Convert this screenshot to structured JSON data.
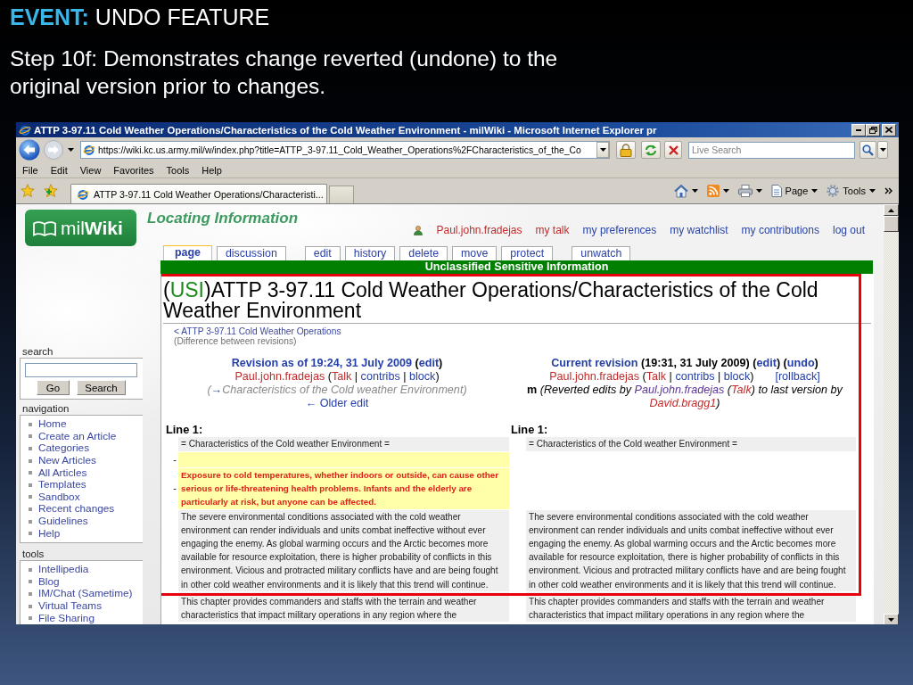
{
  "slide": {
    "heading": "**EVENT:** UNDO FEATURE",
    "step": "Step 10f: Demonstrates change reverted (undone) to the original version prior to changes."
  },
  "window": {
    "title": "ATTP 3-97.11 Cold Weather Operations/Characteristics of the Cold Weather Environment - milWiki - Microsoft Internet Explorer pr"
  },
  "address_bar": {
    "url": "https://wiki.kc.us.army.mil/w/index.php?title=ATTP_3-97.11_Cold_Weather_Operations%2FCharacteristics_of_the_Co"
  },
  "search": {
    "placeholder": "Live Search"
  },
  "menu_bar": [
    "File",
    "Edit",
    "View",
    "Favorites",
    "Tools",
    "Help"
  ],
  "browser_tabs": [
    {
      "label": "ATTP 3-97.11 Cold Weather Operations/Characteristi...",
      "selected": true
    }
  ],
  "command_bar": [
    {
      "kind": "page",
      "label": "Page"
    },
    {
      "kind": "tools",
      "label": "Tools"
    }
  ],
  "wiki": {
    "logo": "mil**Wiki**",
    "site_notice": "Locating Information",
    "user_links": [
      {
        "label": "Paul.john.fradejas",
        "kind": "user"
      },
      {
        "label": "my talk",
        "kind": "new"
      },
      {
        "label": "my preferences",
        "kind": "link"
      },
      {
        "label": "my watchlist",
        "kind": "link"
      },
      {
        "label": "my contributions",
        "kind": "link"
      },
      {
        "label": "log out",
        "kind": "link"
      }
    ],
    "tab_groups": [
      [
        {
          "label": "page",
          "selected": true
        },
        {
          "label": "discussion",
          "selected": false
        }
      ],
      [
        {
          "label": "edit",
          "selected": false
        },
        {
          "label": "history",
          "selected": false
        },
        {
          "label": "delete",
          "selected": false
        },
        {
          "label": "move",
          "selected": false
        },
        {
          "label": "protect",
          "selected": false
        }
      ],
      [
        {
          "label": "unwatch",
          "selected": false
        }
      ]
    ],
    "banner": "Unclassified Sensitive Information",
    "sidebar": {
      "search": {
        "heading": "search",
        "buttons": [
          "Go",
          "Search"
        ]
      },
      "portlets": [
        {
          "heading": "navigation",
          "items": [
            "Home",
            "Create an Article",
            "Categories",
            "New Articles",
            "All Articles",
            "Templates",
            "Sandbox",
            "Recent changes",
            "Guidelines",
            "Help"
          ]
        },
        {
          "heading": "tools",
          "items": [
            "Intellipedia",
            "Blog",
            "IM/Chat (Sametime)",
            "Virtual Teams",
            "File Sharing"
          ]
        }
      ]
    },
    "article": {
      "title": [
        {
          "text": "(",
          "kind": "plain"
        },
        {
          "text": "USI",
          "kind": "marking"
        },
        {
          "text": ")ATTP 3-97.11 Cold Weather Operations/Characteristics of the Cold Weather Environment",
          "kind": "plain"
        }
      ],
      "back_link": "< ATTP 3-97.11 Cold Weather Operations",
      "subtitle": "(Difference between revisions)",
      "revisions": [
        {
          "lines": [
            {
              "segments": [
                {
                  "text": "Revision as of 19:24, 31 July 2009",
                  "kind": "link"
                },
                {
                  "text": " (",
                  "kind": "plain"
                },
                {
                  "text": "edit",
                  "kind": "link"
                },
                {
                  "text": ")",
                  "kind": "plain"
                }
              ]
            },
            {
              "segments": [
                {
                  "text": "Paul.john.fradejas",
                  "kind": "new"
                },
                {
                  "text": " (",
                  "kind": "plain"
                },
                {
                  "text": "Talk",
                  "kind": "new"
                },
                {
                  "text": " | ",
                  "kind": "plain"
                },
                {
                  "text": "contribs",
                  "kind": "link"
                },
                {
                  "text": " | ",
                  "kind": "plain"
                },
                {
                  "text": "block",
                  "kind": "link"
                },
                {
                  "text": ")",
                  "kind": "plain"
                }
              ]
            },
            {
              "segments": [
                {
                  "text": "(",
                  "kind": "muted"
                },
                {
                  "text": "→",
                  "kind": "link"
                },
                {
                  "text": "Characteristics of the Cold weather Environment",
                  "kind": "muted"
                },
                {
                  "text": ")",
                  "kind": "muted"
                }
              ]
            },
            {
              "segments": [
                {
                  "text": "← Older edit",
                  "kind": "link"
                }
              ]
            }
          ]
        },
        {
          "lines": [
            {
              "segments": [
                {
                  "text": "Current revision",
                  "kind": "link"
                },
                {
                  "text": " (19:31, 31 July 2009) (",
                  "kind": "plain"
                },
                {
                  "text": "edit",
                  "kind": "link"
                },
                {
                  "text": ") (",
                  "kind": "plain"
                },
                {
                  "text": "undo",
                  "kind": "link"
                },
                {
                  "text": ")",
                  "kind": "plain"
                }
              ]
            },
            {
              "segments": [
                {
                  "text": "Paul.john.fradejas",
                  "kind": "new"
                },
                {
                  "text": " (",
                  "kind": "plain"
                },
                {
                  "text": "Talk",
                  "kind": "new"
                },
                {
                  "text": " | ",
                  "kind": "plain"
                },
                {
                  "text": "contribs",
                  "kind": "link"
                },
                {
                  "text": " | ",
                  "kind": "plain"
                },
                {
                  "text": "block",
                  "kind": "link"
                },
                {
                  "text": ")",
                  "kind": "plain"
                },
                {
                  "text": "[rollback]",
                  "kind": "action"
                }
              ]
            },
            {
              "segments": [
                {
                  "text": "m",
                  "kind": "minor"
                },
                {
                  "text": " (Reverted edits by ",
                  "kind": "plain"
                },
                {
                  "text": "Paul.john.fradejas",
                  "kind": "visited"
                },
                {
                  "text": " (",
                  "kind": "plain"
                },
                {
                  "text": "Talk",
                  "kind": "new"
                },
                {
                  "text": ") to last version by ",
                  "kind": "plain"
                },
                {
                  "text": "David.bragg1",
                  "kind": "new"
                },
                {
                  "text": ")",
                  "kind": "plain"
                }
              ]
            }
          ]
        }
      ],
      "line_labels": [
        "Line 1:",
        "Line 1:"
      ],
      "rows": [
        {
          "kind": "context",
          "left": "= Characteristics of the Cold weather Environment =",
          "right": "= Characteristics of the Cold weather Environment ="
        },
        {
          "kind": "deleted",
          "marker": "-"
        },
        {
          "kind": "deleted",
          "marker": "-",
          "left": "Exposure to cold temperatures, whether indoors or outside, can cause other serious or life-threatening health problems. Infants and the elderly are particularly at risk, but anyone can be affected."
        },
        {
          "kind": "context",
          "left": "The severe environmental conditions associated with the cold weather environment can render individuals and units combat ineffective without ever engaging the enemy. As global warming occurs and the Arctic becomes more available for resource exploitation, there is higher probability of conflicts in this environment. Vicious and protracted military conflicts have and are being fought in other cold weather environments and it is likely that this trend will continue.",
          "right": "The severe environmental conditions associated with the cold weather environment can render individuals and units combat ineffective without ever engaging the enemy. As global warming occurs and the Arctic becomes more available for resource exploitation, there is higher probability of conflicts in this environment. Vicious and protracted military conflicts have and are being fought in other cold weather environments and it is likely that this trend will continue."
        },
        {
          "kind": "context",
          "left": "This chapter provides commanders and staffs with the terrain and weather characteristics that impact military operations in any region where the",
          "right": "This chapter provides commanders and staffs with the terrain and weather characteristics that impact military operations in any region where the"
        }
      ]
    }
  }
}
